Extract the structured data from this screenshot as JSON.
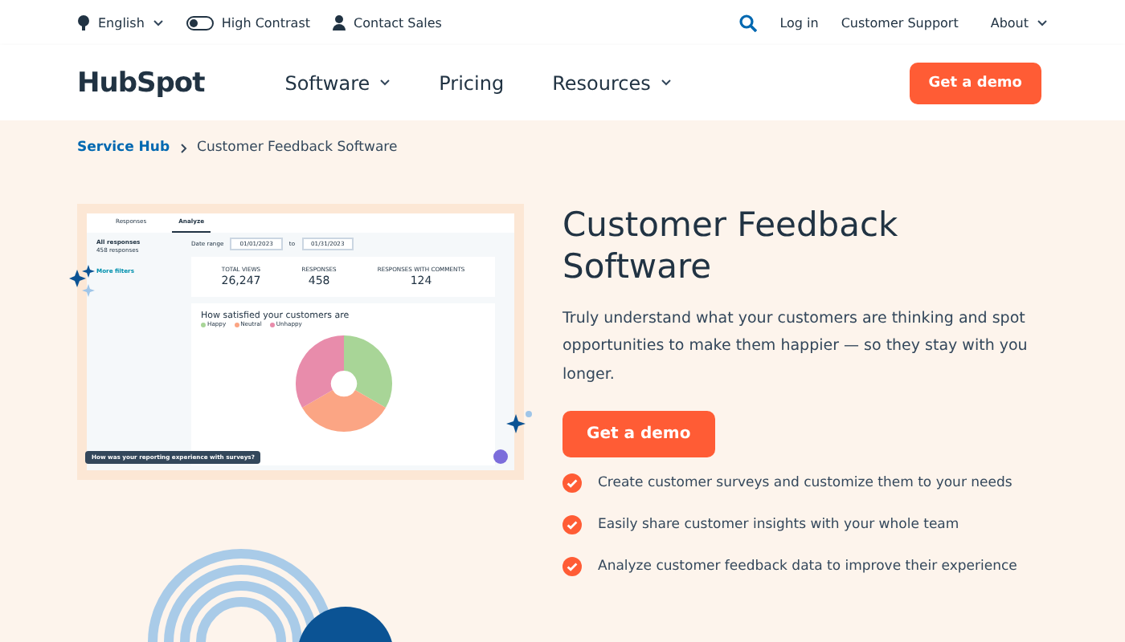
{
  "utility_bar": {
    "language": "English",
    "high_contrast": {
      "label": "High Contrast",
      "on": false
    },
    "contact": "Contact Sales",
    "login": "Log in",
    "support": "Customer Support",
    "about": "About"
  },
  "nav": {
    "logo": "HubSpot",
    "items": [
      {
        "label": "Software",
        "dropdown": true
      },
      {
        "label": "Pricing",
        "dropdown": false
      },
      {
        "label": "Resources",
        "dropdown": true
      }
    ],
    "cta": "Get a demo"
  },
  "breadcrumb": {
    "parent": "Service Hub",
    "current": "Customer Feedback Software"
  },
  "preview": {
    "tabs": [
      {
        "label": "Responses",
        "selected": false
      },
      {
        "label": "Analyze",
        "selected": true
      }
    ],
    "filter_title": "All responses",
    "filter_sub": "458 responses",
    "more_filters": "More filters",
    "date_label": "Date range",
    "date_from": "01/01/2023",
    "date_sep": "to",
    "date_to": "01/31/2023",
    "stats": [
      {
        "label": "TOTAL VIEWS",
        "value": "26,247"
      },
      {
        "label": "RESPONSES",
        "value": "458"
      },
      {
        "label": "RESPONSES WITH COMMENTS",
        "value": "124"
      }
    ],
    "chart_title": "How satisfied your customers are",
    "legend": [
      {
        "label": "Happy",
        "color": "#a8d597"
      },
      {
        "label": "Neutral",
        "color": "#fba584"
      },
      {
        "label": "Unhappy",
        "color": "#e88cab"
      }
    ],
    "survey_prompt": "How was your reporting experience with surveys?"
  },
  "hero": {
    "title": "Customer Feedback Software",
    "body": "Truly understand what your customers are thinking and spot opportunities to make them happier — so they stay with you longer.",
    "cta": "Get a demo",
    "features": [
      "Create customer surveys and customize them to your needs",
      "Easily share customer insights with your whole team",
      "Analyze customer feedback data to improve their experience"
    ]
  }
}
